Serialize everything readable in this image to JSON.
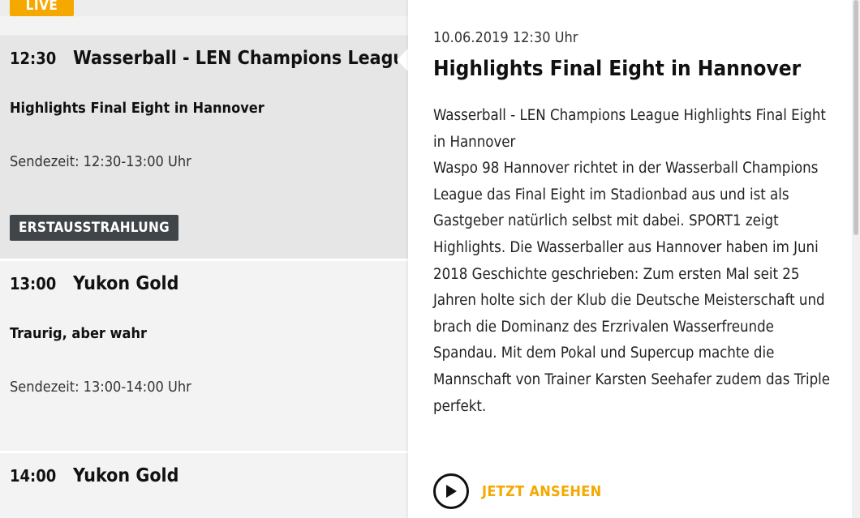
{
  "live_badge": "LIVE",
  "entries": [
    {
      "time": "12:30",
      "title": "Wasserball - LEN Champions League",
      "subtitle": "Highlights Final Eight in Hannover",
      "airtime": "Sendezeit: 12:30-13:00 Uhr",
      "badge": "ERSTAUSSTRAHLUNG"
    },
    {
      "time": "13:00",
      "title": "Yukon Gold",
      "subtitle": "Traurig, aber wahr",
      "airtime": "Sendezeit: 13:00-14:00 Uhr"
    },
    {
      "time": "14:00",
      "title": "Yukon Gold"
    }
  ],
  "detail": {
    "datetime": "10.06.2019 12:30 Uhr",
    "title": "Highlights Final Eight in Hannover",
    "description_line1": "Wasserball - LEN Champions League Highlights Final Eight in Hannover",
    "description_line2": "Waspo 98 Hannover richtet in der Wasserball Champions League das Final Eight im Stadionbad aus und ist als Gastgeber natürlich selbst mit dabei. SPORT1 zeigt Highlights. Die Wasserballer aus Hannover haben im Juni 2018 Geschichte geschrieben: Zum ersten Mal seit 25 Jahren holte sich der Klub die Deutsche Meisterschaft und brach die Dominanz des Erzrivalen Wasserfreunde Spandau. Mit dem Pokal und Supercup machte die Mannschaft von Trainer Karsten Seehafer zudem das Triple perfekt.",
    "watch_label": "JETZT ANSEHEN",
    "watch_icon": "play-circle-icon"
  },
  "colors": {
    "accent": "#f5a800",
    "badge_dark": "#3f4548",
    "active_bg": "#e6e6e6",
    "list_bg": "#f3f3f3"
  }
}
